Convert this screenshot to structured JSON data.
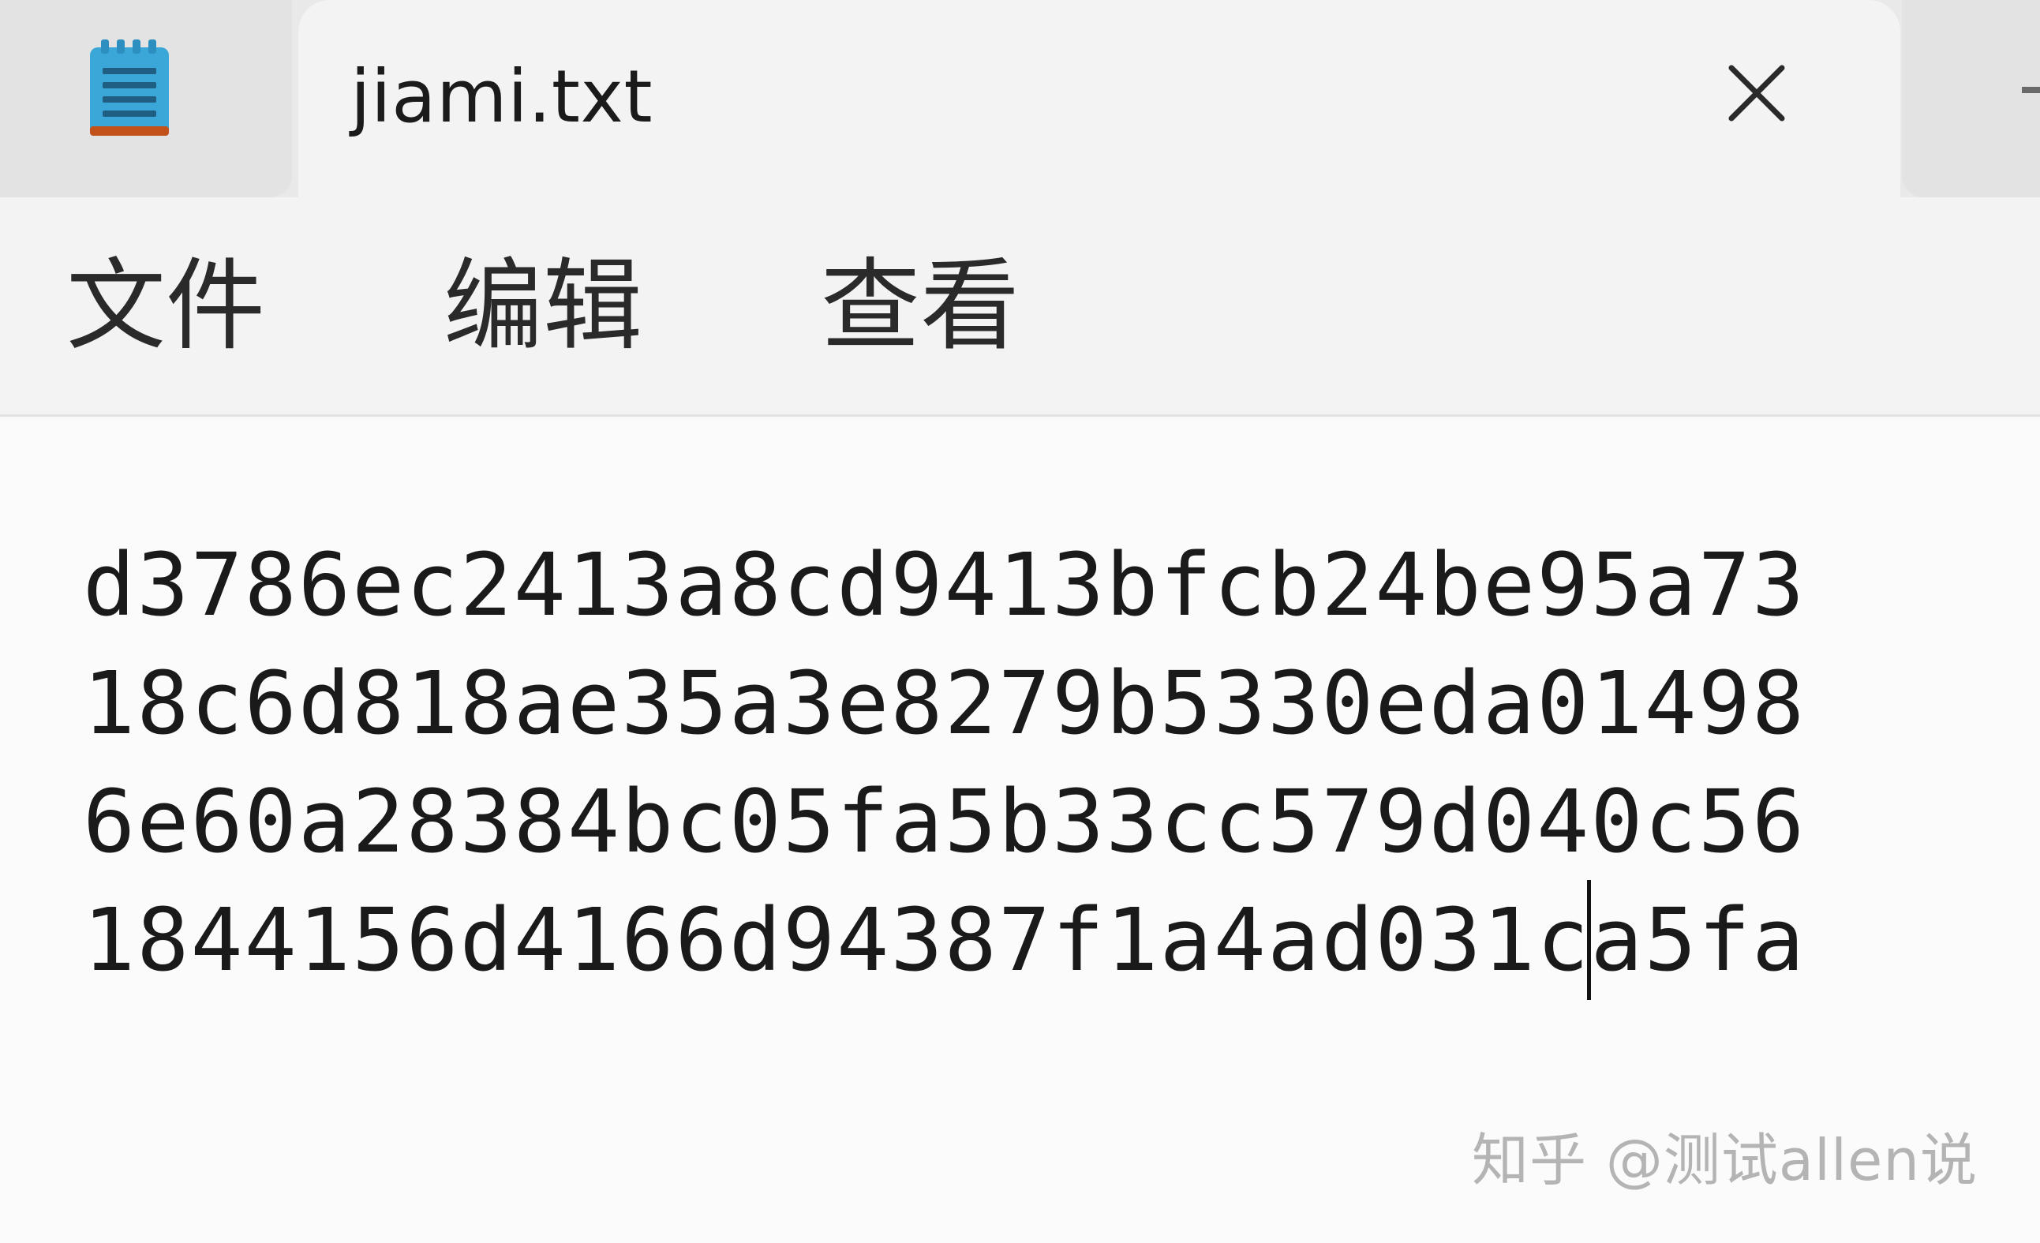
{
  "tab": {
    "title": "jiami.txt",
    "app_icon": "notepad-icon",
    "close_icon": "close-icon"
  },
  "menu": {
    "file": "文件",
    "edit": "编辑",
    "view": "查看"
  },
  "editor": {
    "lines": [
      "d3786ec2413a8cd9413bfcb24be95a73",
      "18c6d818ae35a3e8279b5330eda01498",
      "6e60a28384bc05fa5b33cc579d040c56",
      "1844156d4166d94387f1a4ad031ca5fa"
    ]
  },
  "watermark": "知乎 @测试allen说",
  "colors": {
    "icon_blue": "#3aa7d8",
    "icon_stripe": "#1f5f84",
    "icon_base": "#c2511a"
  }
}
